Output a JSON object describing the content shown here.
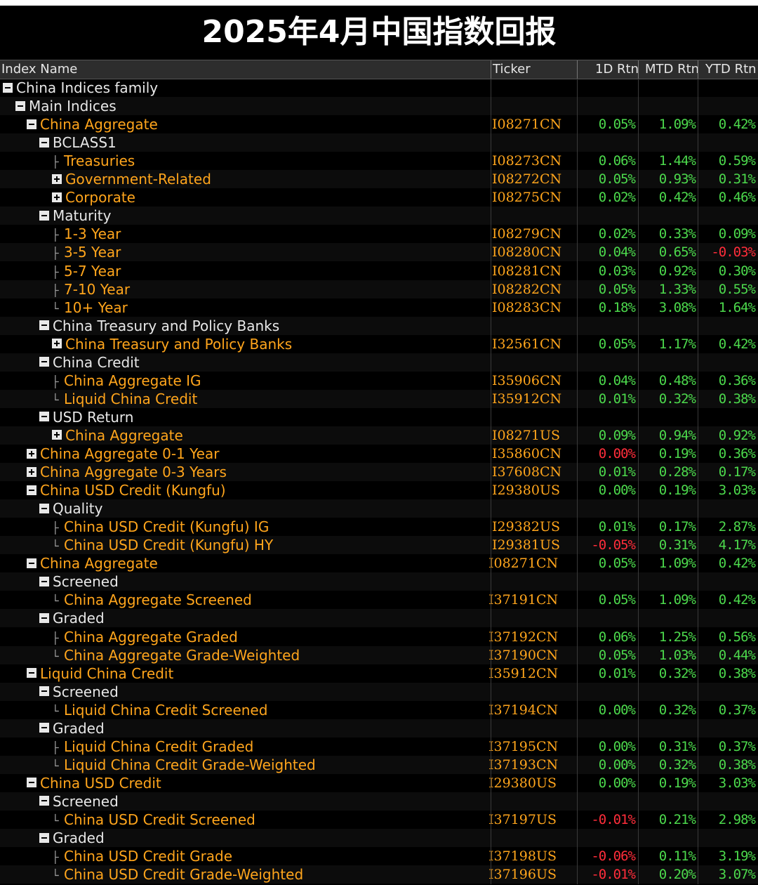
{
  "title": "2025年4月中国指数回报",
  "columns": {
    "name": "Index Name",
    "ticker": "Ticker",
    "d1": "1D Rtn",
    "mtd": "MTD Rtn",
    "ytd": "YTD Rtn"
  },
  "rows": [
    {
      "name": "China Indices family",
      "level": 0,
      "icon": "minus",
      "color": "white",
      "ticker": "",
      "d1": "",
      "mtd": "",
      "ytd": ""
    },
    {
      "name": "Main Indices",
      "level": 1,
      "icon": "minus",
      "color": "white",
      "ticker": "",
      "d1": "",
      "mtd": "",
      "ytd": ""
    },
    {
      "name": "China Aggregate",
      "level": 2,
      "icon": "minus",
      "color": "orange",
      "ticker": "I08271CN",
      "d1": "0.05%",
      "mtd": "1.09%",
      "ytd": "0.42%"
    },
    {
      "name": "BCLASS1",
      "level": 3,
      "icon": "minus",
      "color": "white",
      "ticker": "",
      "d1": "",
      "mtd": "",
      "ytd": ""
    },
    {
      "name": "Treasuries",
      "level": 4,
      "icon": "tee",
      "color": "orange",
      "ticker": "I08273CN",
      "d1": "0.06%",
      "mtd": "1.44%",
      "ytd": "0.59%"
    },
    {
      "name": "Government-Related",
      "level": 4,
      "icon": "plus",
      "color": "orange",
      "ticker": "I08272CN",
      "d1": "0.05%",
      "mtd": "0.93%",
      "ytd": "0.31%"
    },
    {
      "name": "Corporate",
      "level": 4,
      "icon": "plus",
      "color": "orange",
      "ticker": "I08275CN",
      "d1": "0.02%",
      "mtd": "0.42%",
      "ytd": "0.46%"
    },
    {
      "name": "Maturity",
      "level": 3,
      "icon": "minus",
      "color": "white",
      "ticker": "",
      "d1": "",
      "mtd": "",
      "ytd": ""
    },
    {
      "name": "1-3 Year",
      "level": 4,
      "icon": "tee",
      "color": "orange",
      "ticker": "I08279CN",
      "d1": "0.02%",
      "mtd": "0.33%",
      "ytd": "0.09%"
    },
    {
      "name": "3-5 Year",
      "level": 4,
      "icon": "tee",
      "color": "orange",
      "ticker": "I08280CN",
      "d1": "0.04%",
      "mtd": "0.65%",
      "ytd": "-0.03%"
    },
    {
      "name": "5-7 Year",
      "level": 4,
      "icon": "tee",
      "color": "orange",
      "ticker": "I08281CN",
      "d1": "0.03%",
      "mtd": "0.92%",
      "ytd": "0.30%"
    },
    {
      "name": "7-10 Year",
      "level": 4,
      "icon": "tee",
      "color": "orange",
      "ticker": "I08282CN",
      "d1": "0.05%",
      "mtd": "1.33%",
      "ytd": "0.55%"
    },
    {
      "name": "10+ Year",
      "level": 4,
      "icon": "end",
      "color": "orange",
      "ticker": "I08283CN",
      "d1": "0.18%",
      "mtd": "3.08%",
      "ytd": "1.64%"
    },
    {
      "name": "China Treasury and Policy Banks",
      "level": 3,
      "icon": "minus",
      "color": "white",
      "ticker": "",
      "d1": "",
      "mtd": "",
      "ytd": ""
    },
    {
      "name": "China Treasury and Policy Banks",
      "level": 4,
      "icon": "plus",
      "color": "orange",
      "ticker": "I32561CN",
      "d1": "0.05%",
      "mtd": "1.17%",
      "ytd": "0.42%"
    },
    {
      "name": "China Credit",
      "level": 3,
      "icon": "minus",
      "color": "white",
      "ticker": "",
      "d1": "",
      "mtd": "",
      "ytd": ""
    },
    {
      "name": "China Aggregate IG",
      "level": 4,
      "icon": "tee",
      "color": "orange",
      "ticker": "I35906CN",
      "d1": "0.04%",
      "mtd": "0.48%",
      "ytd": "0.36%"
    },
    {
      "name": "Liquid China Credit",
      "level": 4,
      "icon": "end",
      "color": "orange",
      "ticker": "I35912CN",
      "d1": "0.01%",
      "mtd": "0.32%",
      "ytd": "0.38%"
    },
    {
      "name": "USD Return",
      "level": 3,
      "icon": "minus",
      "color": "white",
      "ticker": "",
      "d1": "",
      "mtd": "",
      "ytd": ""
    },
    {
      "name": "China Aggregate",
      "level": 4,
      "icon": "plus",
      "color": "orange",
      "ticker": "I08271US",
      "d1": "0.09%",
      "mtd": "0.94%",
      "ytd": "0.92%"
    },
    {
      "name": "China Aggregate 0-1 Year",
      "level": 2,
      "icon": "plus",
      "color": "orange",
      "ticker": "I35860CN",
      "d1": "0.00%",
      "mtd": "0.19%",
      "ytd": "0.36%"
    },
    {
      "name": "China Aggregate 0-3 Years",
      "level": 2,
      "icon": "plus",
      "color": "orange",
      "ticker": "I37608CN",
      "d1": "0.01%",
      "mtd": "0.28%",
      "ytd": "0.17%"
    },
    {
      "name": "China USD Credit (Kungfu)",
      "level": 2,
      "icon": "minus",
      "color": "orange",
      "ticker": "I29380US",
      "d1": "0.00%",
      "mtd": "0.19%",
      "ytd": "3.03%"
    },
    {
      "name": "Quality",
      "level": 3,
      "icon": "minus",
      "color": "white",
      "ticker": "",
      "d1": "",
      "mtd": "",
      "ytd": ""
    },
    {
      "name": "China USD Credit (Kungfu) IG",
      "level": 4,
      "icon": "tee",
      "color": "orange",
      "ticker": "I29382US",
      "d1": "0.01%",
      "mtd": "0.17%",
      "ytd": "2.87%"
    },
    {
      "name": "China USD Credit (Kungfu) HY",
      "level": 4,
      "icon": "end",
      "color": "orange",
      "ticker": "I29381US",
      "d1": "-0.05%",
      "mtd": "0.31%",
      "ytd": "4.17%"
    },
    {
      "name": "China Aggregate",
      "level": 2,
      "icon": "minus",
      "color": "orange",
      "ticker": "I08271CN",
      "d1": "0.05%",
      "mtd": "1.09%",
      "ytd": "0.42%"
    },
    {
      "name": "Screened",
      "level": 3,
      "icon": "minus",
      "color": "white",
      "ticker": "",
      "d1": "",
      "mtd": "",
      "ytd": ""
    },
    {
      "name": "China Aggregate Screened",
      "level": 4,
      "icon": "end",
      "color": "orange",
      "ticker": "I37191CN",
      "d1": "0.05%",
      "mtd": "1.09%",
      "ytd": "0.42%"
    },
    {
      "name": "Graded",
      "level": 3,
      "icon": "minus",
      "color": "white",
      "ticker": "",
      "d1": "",
      "mtd": "",
      "ytd": ""
    },
    {
      "name": "China Aggregate Graded",
      "level": 4,
      "icon": "tee",
      "color": "orange",
      "ticker": "I37192CN",
      "d1": "0.06%",
      "mtd": "1.25%",
      "ytd": "0.56%"
    },
    {
      "name": "China Aggregate Grade-Weighted",
      "level": 4,
      "icon": "end",
      "color": "orange",
      "ticker": "I37190CN",
      "d1": "0.05%",
      "mtd": "1.03%",
      "ytd": "0.44%"
    },
    {
      "name": "Liquid China Credit",
      "level": 2,
      "icon": "minus",
      "color": "orange",
      "ticker": "I35912CN",
      "d1": "0.01%",
      "mtd": "0.32%",
      "ytd": "0.38%"
    },
    {
      "name": "Screened",
      "level": 3,
      "icon": "minus",
      "color": "white",
      "ticker": "",
      "d1": "",
      "mtd": "",
      "ytd": ""
    },
    {
      "name": "Liquid China Credit Screened",
      "level": 4,
      "icon": "end",
      "color": "orange",
      "ticker": "I37194CN",
      "d1": "0.00%",
      "mtd": "0.32%",
      "ytd": "0.37%"
    },
    {
      "name": "Graded",
      "level": 3,
      "icon": "minus",
      "color": "white",
      "ticker": "",
      "d1": "",
      "mtd": "",
      "ytd": ""
    },
    {
      "name": "Liquid China Credit Graded",
      "level": 4,
      "icon": "tee",
      "color": "orange",
      "ticker": "I37195CN",
      "d1": "0.00%",
      "mtd": "0.31%",
      "ytd": "0.37%"
    },
    {
      "name": "Liquid China Credit Grade-Weighted",
      "level": 4,
      "icon": "end",
      "color": "orange",
      "ticker": "I37193CN",
      "d1": "0.00%",
      "mtd": "0.32%",
      "ytd": "0.38%"
    },
    {
      "name": "China USD Credit",
      "level": 2,
      "icon": "minus",
      "color": "orange",
      "ticker": "I29380US",
      "d1": "0.00%",
      "mtd": "0.19%",
      "ytd": "3.03%"
    },
    {
      "name": "Screened",
      "level": 3,
      "icon": "minus",
      "color": "white",
      "ticker": "",
      "d1": "",
      "mtd": "",
      "ytd": ""
    },
    {
      "name": "China USD Credit Screened",
      "level": 4,
      "icon": "end",
      "color": "orange",
      "ticker": "I37197US",
      "d1": "-0.01%",
      "mtd": "0.21%",
      "ytd": "2.98%"
    },
    {
      "name": "Graded",
      "level": 3,
      "icon": "minus",
      "color": "white",
      "ticker": "",
      "d1": "",
      "mtd": "",
      "ytd": ""
    },
    {
      "name": "China USD Credit Grade",
      "level": 4,
      "icon": "tee",
      "color": "orange",
      "ticker": "I37198US",
      "d1": "-0.06%",
      "mtd": "0.11%",
      "ytd": "3.19%"
    },
    {
      "name": "China USD Credit Grade-Weighted",
      "level": 4,
      "icon": "end",
      "color": "orange",
      "ticker": "I37196US",
      "d1": "-0.01%",
      "mtd": "0.20%",
      "ytd": "3.07%"
    }
  ],
  "colors": {
    "positive": "#4cd94c",
    "negative": "#ff2d3a",
    "highlight": "#ffa51c",
    "label": "#e8e8e8"
  },
  "red_cells": [
    "9.ytd",
    "20.d1",
    "25.d1",
    "40.d1",
    "42.d1",
    "43.d1"
  ]
}
